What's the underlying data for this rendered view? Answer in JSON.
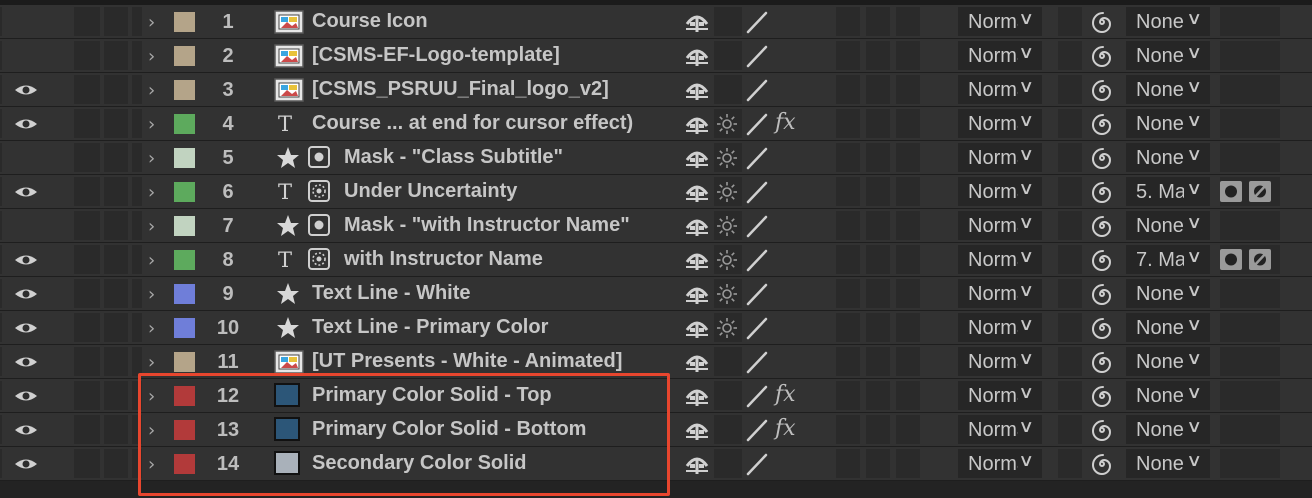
{
  "colors": {
    "label_tan": "#b4a489",
    "label_green": "#5daa5d",
    "label_seafoam": "#c1d3c0",
    "label_blue": "#6f7ed9",
    "label_red": "#b23a3a",
    "solid_primary": "#2c5678",
    "solid_secondary": "#a9b1ba",
    "highlight": "#e8462e"
  },
  "layers": [
    {
      "num": "1",
      "name": "Course Icon",
      "visible": false,
      "label_color": "#b4a489",
      "type": "footage",
      "source": "",
      "sun": false,
      "fx": false,
      "mode": "Normal",
      "parent": "None",
      "track_matte": false
    },
    {
      "num": "2",
      "name": "[CSMS-EF-Logo-template]",
      "visible": false,
      "label_color": "#b4a489",
      "type": "footage",
      "source": "",
      "sun": false,
      "fx": false,
      "mode": "Normal",
      "parent": "None",
      "track_matte": false
    },
    {
      "num": "3",
      "name": "[CSMS_PSRUU_Final_logo_v2]",
      "visible": true,
      "label_color": "#b4a489",
      "type": "footage",
      "source": "",
      "sun": false,
      "fx": false,
      "mode": "Normal",
      "parent": "None",
      "track_matte": false
    },
    {
      "num": "4",
      "name": "Course ... at end for cursor effect)",
      "visible": true,
      "label_color": "#5daa5d",
      "type": "text",
      "source": "",
      "sun": true,
      "fx": true,
      "mode": "Normal",
      "parent": "None",
      "track_matte": false
    },
    {
      "num": "5",
      "name": "Mask - \"Class Subtitle\"",
      "visible": false,
      "label_color": "#c1d3c0",
      "type": "shape",
      "source": "matte",
      "sun": true,
      "fx": false,
      "mode": "Normal",
      "parent": "None",
      "track_matte": false
    },
    {
      "num": "6",
      "name": "Under Uncertainty",
      "visible": true,
      "label_color": "#5daa5d",
      "type": "text",
      "source": "matted",
      "sun": true,
      "fx": false,
      "mode": "Normal",
      "parent": "5. Ma",
      "track_matte": true
    },
    {
      "num": "7",
      "name": "Mask - \"with Instructor Name\"",
      "visible": false,
      "label_color": "#c1d3c0",
      "type": "shape",
      "source": "matte",
      "sun": true,
      "fx": false,
      "mode": "Normal",
      "parent": "None",
      "track_matte": false
    },
    {
      "num": "8",
      "name": "with Instructor Name",
      "visible": true,
      "label_color": "#5daa5d",
      "type": "text",
      "source": "matted",
      "sun": true,
      "fx": false,
      "mode": "Normal",
      "parent": "7. Ma",
      "track_matte": true
    },
    {
      "num": "9",
      "name": "Text Line - White",
      "visible": true,
      "label_color": "#6f7ed9",
      "type": "shape",
      "source": "",
      "sun": true,
      "fx": false,
      "mode": "Normal",
      "parent": "None",
      "track_matte": false
    },
    {
      "num": "10",
      "name": "Text Line - Primary Color",
      "visible": true,
      "label_color": "#6f7ed9",
      "type": "shape",
      "source": "",
      "sun": true,
      "fx": false,
      "mode": "Normal",
      "parent": "None",
      "track_matte": false
    },
    {
      "num": "11",
      "name": "[UT Presents - White - Animated]",
      "visible": true,
      "label_color": "#b4a489",
      "type": "footage",
      "source": "",
      "sun": false,
      "fx": false,
      "mode": "Normal",
      "parent": "None",
      "track_matte": false
    },
    {
      "num": "12",
      "name": "Primary Color Solid - Top",
      "visible": true,
      "label_color": "#b23a3a",
      "type": "solid",
      "solid_color": "#2c5678",
      "source": "",
      "sun": false,
      "fx": true,
      "mode": "Normal",
      "parent": "None",
      "track_matte": false
    },
    {
      "num": "13",
      "name": "Primary Color Solid - Bottom",
      "visible": true,
      "label_color": "#b23a3a",
      "type": "solid",
      "solid_color": "#2c5678",
      "source": "",
      "sun": false,
      "fx": true,
      "mode": "Normal",
      "parent": "None",
      "track_matte": false
    },
    {
      "num": "14",
      "name": "Secondary Color Solid",
      "visible": true,
      "label_color": "#b23a3a",
      "type": "solid",
      "solid_color": "#a9b1ba",
      "source": "",
      "sun": false,
      "fx": false,
      "mode": "Normal",
      "parent": "None",
      "track_matte": false
    }
  ]
}
